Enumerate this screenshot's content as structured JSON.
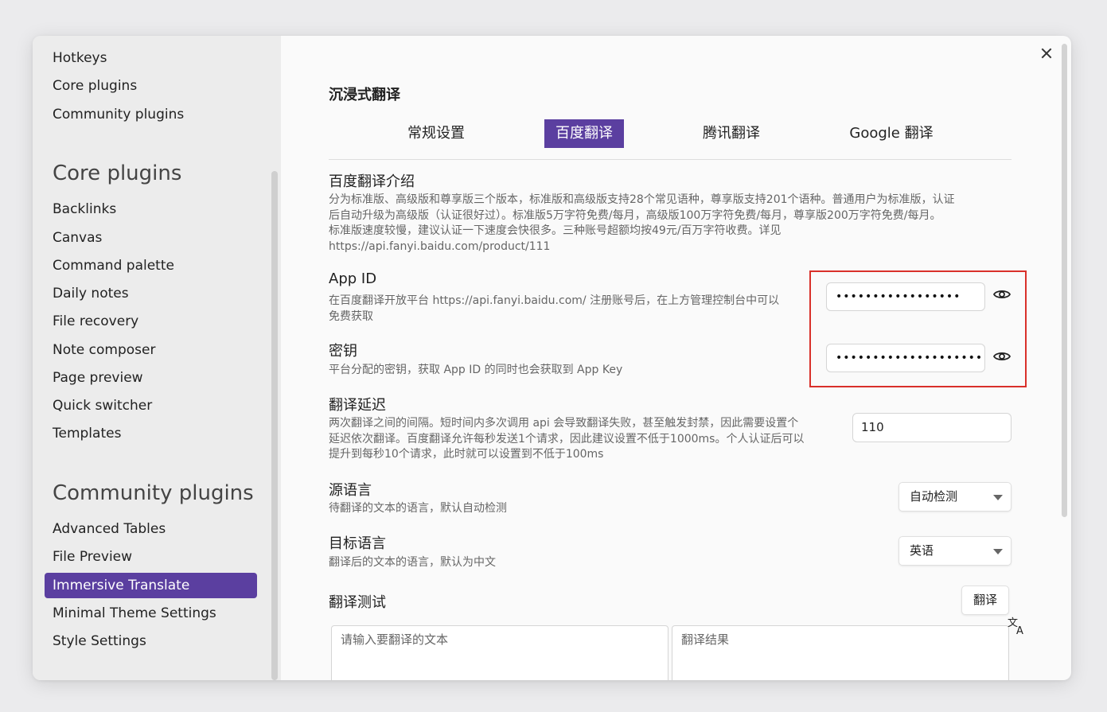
{
  "sidebar": {
    "options_items": [
      "Hotkeys",
      "Core plugins",
      "Community plugins"
    ],
    "core_heading": "Core plugins",
    "core_items": [
      "Backlinks",
      "Canvas",
      "Command palette",
      "Daily notes",
      "File recovery",
      "Note composer",
      "Page preview",
      "Quick switcher",
      "Templates"
    ],
    "community_heading": "Community plugins",
    "community_items": [
      "Advanced Tables",
      "File Preview",
      "Immersive Translate",
      "Minimal Theme Settings",
      "Style Settings"
    ],
    "active_item": "Immersive Translate"
  },
  "settings": {
    "title": "沉浸式翻译",
    "tabs": [
      "常规设置",
      "百度翻译",
      "腾讯翻译",
      "Google 翻译"
    ],
    "active_tab": "百度翻译",
    "intro_title": "百度翻译介绍",
    "intro_lines": [
      "分为标准版、高级版和尊享版三个版本，标准版和高级版支持28个常见语种，尊享版支持201个语种。普通用户为标准版，认证",
      "后自动升级为高级版（认证很好过）。标准版5万字符免费/每月，高级版100万字符免费/每月，尊享版200万字符免费/每月。",
      "标准版速度较慢，建议认证一下速度会快很多。三种账号超额均按49元/百万字符收费。详见",
      "https://api.fanyi.baidu.com/product/111"
    ],
    "app_id_title": "App ID",
    "app_id_lines": [
      "在百度翻译开放平台 https://api.fanyi.baidu.com/ 注册账号后，在上方管理控制台中可以",
      "免费获取"
    ],
    "app_id_value": "•••••••••••••••••",
    "key_title": "密钥",
    "key_lines": [
      "平台分配的密钥，获取 App ID 的同时也会获取到 App Key"
    ],
    "key_value": "••••••••••••••••••••",
    "delay_title": "翻译延迟",
    "delay_lines": [
      "两次翻译之间的间隔。短时间内多次调用 api 会导致翻译失败，甚至触发封禁，因此需要设置个",
      "延迟依次翻译。百度翻译允许每秒发送1个请求，因此建议设置不低于1000ms。个人认证后可以",
      "提升到每秒10个请求，此时就可以设置到不低于100ms"
    ],
    "delay_value": "110",
    "source_title": "源语言",
    "source_lines": [
      "待翻译的文本的语言，默认自动检测"
    ],
    "source_value": "自动检测",
    "target_title": "目标语言",
    "target_lines": [
      "翻译后的文本的语言，默认为中文"
    ],
    "target_value": "英语",
    "test_title": "翻译测试",
    "test_button": "翻译",
    "input_placeholder": "请输入要翻译的文本",
    "result_placeholder": "翻译结果"
  },
  "colors": {
    "accent": "#5b3fa0",
    "highlight_box": "#d9302a"
  },
  "icons": [
    "close-icon",
    "eye-icon",
    "translate-icon",
    "chevron-down-icon"
  ]
}
